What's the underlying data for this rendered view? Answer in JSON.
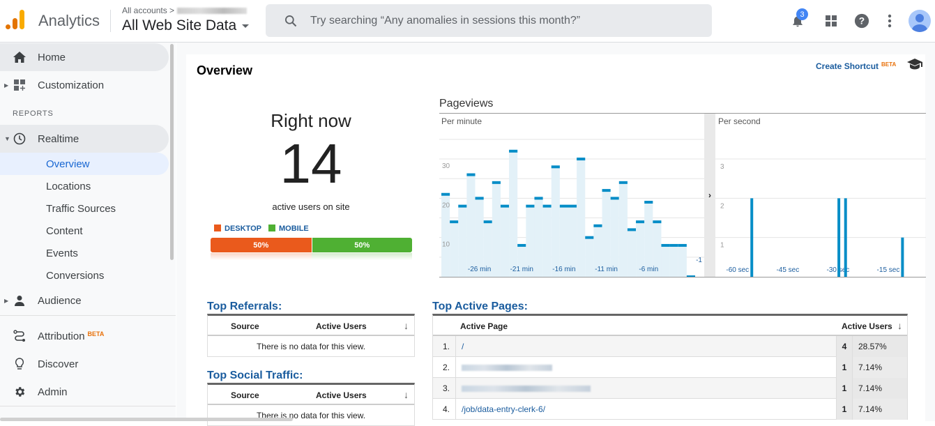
{
  "header": {
    "app_name": "Analytics",
    "breadcrumb": "All accounts >",
    "view_name": "All Web Site Data",
    "search_placeholder": "Try searching “Any anomalies in sessions this month?”",
    "notification_count": "3"
  },
  "sidebar": {
    "items": [
      {
        "label": "Home",
        "icon": "home-icon"
      },
      {
        "label": "Customization",
        "icon": "dashboard-add-icon"
      },
      {
        "label": "Realtime",
        "icon": "clock-icon"
      },
      {
        "label": "Audience",
        "icon": "person-icon"
      },
      {
        "label": "Attribution",
        "icon": "attribution-icon",
        "badge": "BETA"
      },
      {
        "label": "Discover",
        "icon": "lightbulb-icon"
      },
      {
        "label": "Admin",
        "icon": "gear-icon"
      }
    ],
    "section_reports": "REPORTS",
    "realtime_sub": [
      "Overview",
      "Locations",
      "Traffic Sources",
      "Content",
      "Events",
      "Conversions"
    ],
    "active_sub": "Overview"
  },
  "overview": {
    "title": "Overview",
    "create_shortcut": "Create Shortcut",
    "shortcut_badge": "BETA",
    "right_now_label": "Right now",
    "active_users": "14",
    "active_users_caption": "active users on site",
    "device_split": [
      {
        "label": "DESKTOP",
        "percent": 50,
        "percent_label": "50%",
        "color": "#ea5a1c"
      },
      {
        "label": "MOBILE",
        "percent": 50,
        "percent_label": "50%",
        "color": "#4fb033"
      }
    ]
  },
  "chart_data": [
    {
      "type": "bar",
      "title": "Pageviews",
      "subtitle": "Per minute",
      "x_tick_labels": [
        "-26 min",
        "-21 min",
        "-16 min",
        "-11 min",
        "-6 min",
        "-1"
      ],
      "y_tick_labels": [
        "10",
        "20",
        "30"
      ],
      "ylim": [
        0,
        38
      ],
      "minutes_ago": [
        -30,
        -29,
        -28,
        -27,
        -26,
        -25,
        -24,
        -23,
        -22,
        -21,
        -20,
        -19,
        -18,
        -17,
        -16,
        -15,
        -14,
        -13,
        -12,
        -11,
        -10,
        -9,
        -8,
        -7,
        -6,
        -5,
        -4,
        -3,
        -2,
        -1
      ],
      "values": [
        21,
        14,
        18,
        26,
        20,
        14,
        24,
        18,
        32,
        8,
        18,
        20,
        18,
        28,
        18,
        18,
        30,
        10,
        13,
        22,
        20,
        24,
        12,
        14,
        19,
        14,
        8,
        8,
        8,
        0
      ],
      "grid": true
    },
    {
      "type": "bar",
      "subtitle": "Per second",
      "x_tick_labels": [
        "-60 sec",
        "-45 sec",
        "-30 sec",
        "-15 sec"
      ],
      "y_tick_labels": [
        "1",
        "2",
        "3"
      ],
      "ylim": [
        0,
        3.8
      ],
      "seconds_ago": [
        -52,
        -26,
        -24,
        -7
      ],
      "values": [
        2,
        2,
        2,
        1
      ],
      "grid": true
    }
  ],
  "top_referrals": {
    "title": "Top Referrals:",
    "columns": [
      "Source",
      "Active Users"
    ],
    "empty_message": "There is no data for this view."
  },
  "top_social": {
    "title": "Top Social Traffic:",
    "columns": [
      "Source",
      "Active Users"
    ],
    "empty_message": "There is no data for this view."
  },
  "top_pages": {
    "title": "Top Active Pages:",
    "columns": [
      "Active Page",
      "Active Users"
    ],
    "rows": [
      {
        "index": "1.",
        "page": "/",
        "users": "4",
        "percent": "28.57%",
        "redacted": false
      },
      {
        "index": "2.",
        "page": "",
        "users": "1",
        "percent": "7.14%",
        "redacted": true
      },
      {
        "index": "3.",
        "page": "",
        "users": "1",
        "percent": "7.14%",
        "redacted": true
      },
      {
        "index": "4.",
        "page": "/job/data-entry-clerk-6/",
        "users": "1",
        "percent": "7.14%",
        "redacted": false
      }
    ]
  }
}
